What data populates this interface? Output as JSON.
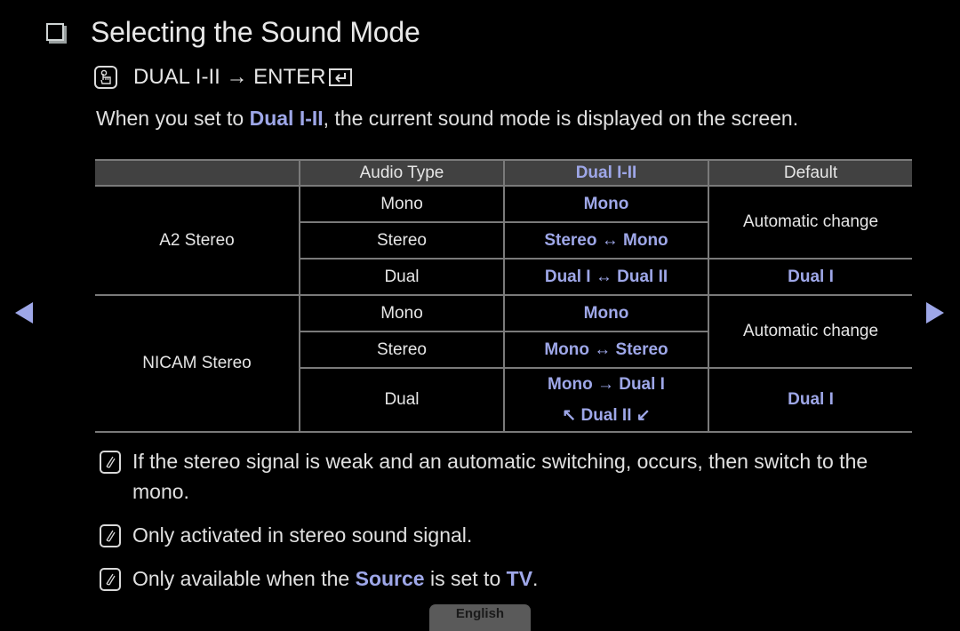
{
  "section": {
    "title": "Selecting the Sound Mode",
    "title_icon": "checkbox-square-icon"
  },
  "menu_path": {
    "icon": "remote-hand-icon",
    "text": "DUAL I-II → ENTER",
    "enter_icon": "enter-key-icon"
  },
  "intro": {
    "before": "When you set to ",
    "highlight": "Dual I-II",
    "after": ", the current sound mode is displayed on the screen."
  },
  "table": {
    "headers": [
      "",
      "Audio Type",
      "Dual I-II",
      "Default"
    ],
    "groups": [
      {
        "name": "A2 Stereo",
        "rows": [
          {
            "audio_type": "Mono",
            "dual": "Mono"
          },
          {
            "audio_type": "Stereo",
            "dual": "Stereo ↔ Mono"
          },
          {
            "audio_type": "Dual",
            "dual": "Dual I ↔ Dual II"
          }
        ],
        "defaults": [
          "Automatic change",
          "Dual I"
        ]
      },
      {
        "name": "NICAM Stereo",
        "rows": [
          {
            "audio_type": "Mono",
            "dual": "Mono"
          },
          {
            "audio_type": "Stereo",
            "dual": "Mono ↔ Stereo"
          },
          {
            "audio_type": "Dual",
            "dual_line1": "Mono → Dual I",
            "dual_line2": "↖ Dual II ↙"
          }
        ],
        "defaults": [
          "Automatic change",
          "Dual I"
        ]
      }
    ]
  },
  "notes": [
    {
      "text": "If the stereo signal is weak and an automatic switching, occurs, then switch to the mono."
    },
    {
      "text": "Only activated in stereo sound signal."
    },
    {
      "before": "Only available when the ",
      "hl1": "Source",
      "mid": " is set to ",
      "hl2": "TV",
      "after": "."
    }
  ],
  "navigation": {
    "prev": "previous-page-arrow",
    "next": "next-page-arrow"
  },
  "language_tab": "English",
  "colors": {
    "background": "#000000",
    "text": "#e6e6e6",
    "accent": "#9ea7e8",
    "table_header": "#414141",
    "table_border": "#7a7a7a",
    "lang_tab": "#5a5a5a"
  }
}
